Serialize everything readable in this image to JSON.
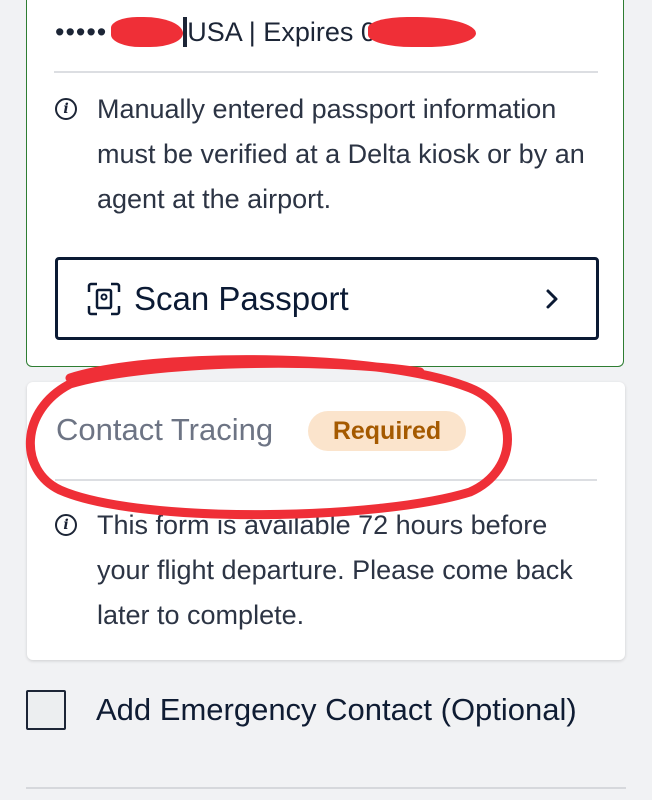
{
  "passport": {
    "masked_number": "•••••",
    "country_expiry": "USA | Expires 0",
    "info_text": "Manually entered passport information must be verified at a Delta kiosk or by an agent at the airport.",
    "scan_button_label": "Scan Passport"
  },
  "contact_tracing": {
    "title": "Contact Tracing",
    "badge": "Required",
    "info_text": "This form is available 72 hours before your flight departure. Please come back later to complete."
  },
  "emergency_contact": {
    "label": "Add Emergency Contact (Optional)",
    "checked": false
  },
  "icons": {
    "info": "info-icon",
    "scan": "scan-document-icon",
    "chevron": "chevron-right-icon"
  },
  "colors": {
    "card_border_green": "#2e7d32",
    "badge_bg": "#fbe4cc",
    "badge_text": "#a55a00",
    "navy": "#0b1a34",
    "annotation_red": "#ef2f37"
  }
}
